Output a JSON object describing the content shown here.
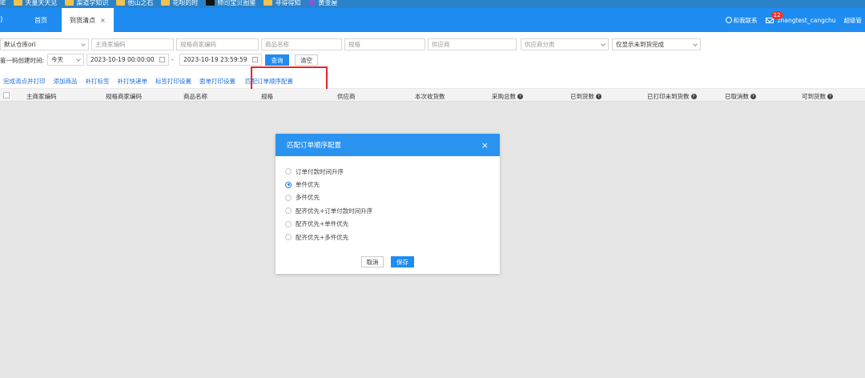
{
  "bookmarks": {
    "items": [
      {
        "label": "IE"
      },
      {
        "label": "天量天天见"
      },
      {
        "label": "渠道学知识"
      },
      {
        "label": "他山之石"
      },
      {
        "label": "花呗的时"
      },
      {
        "label": "帅司宝贝图鉴"
      },
      {
        "label": "寻得得知"
      },
      {
        "label": "黄金屋"
      }
    ]
  },
  "nav": {
    "left_glyph": ")",
    "tabs": [
      {
        "label": "首页"
      },
      {
        "label": "到货清点",
        "close": "×"
      }
    ],
    "support_label": "和我联系",
    "mail_badge": "12",
    "username": "zhangtest_cangchu",
    "admin_label": "超级管"
  },
  "filters": {
    "warehouse": "默认仓库ori",
    "main_code_placeholder": "主商家编码",
    "spec_code_placeholder": "规格商家编码",
    "product_name_placeholder": "商品名称",
    "spec_placeholder": "规格",
    "supplier_placeholder": "供应商",
    "supplier_category_placeholder": "供应商分类",
    "show_incomplete": "仅显示未到货完成",
    "time_label": "鉴一码创建时间:",
    "range": "今天",
    "start_time": "2023-10-19 00:00:00",
    "dash": "-",
    "end_time": "2023-10-19 23:59:59",
    "search_btn": "查询",
    "clear_btn": "清空"
  },
  "actions": {
    "items": [
      {
        "label": "完成清点并打印"
      },
      {
        "label": "添加商品"
      },
      {
        "label": "补打标签"
      },
      {
        "label": "补打快递单"
      },
      {
        "label": "标签打印设置"
      },
      {
        "label": "面单打印设置"
      },
      {
        "label": "匹配订单顺序配置"
      }
    ]
  },
  "table": {
    "columns": [
      {
        "label": "主商家编码",
        "help": false
      },
      {
        "label": "规格商家编码",
        "help": false
      },
      {
        "label": "商品名称",
        "help": false
      },
      {
        "label": "规格",
        "help": false
      },
      {
        "label": "供应商",
        "help": false
      },
      {
        "label": "本次收货数",
        "help": false
      },
      {
        "label": "采购总数",
        "help": true
      },
      {
        "label": "已到货数",
        "help": true
      },
      {
        "label": "已打印未到货数",
        "help": true
      },
      {
        "label": "已取消数",
        "help": true
      },
      {
        "label": "可到货数",
        "help": true
      }
    ]
  },
  "modal": {
    "title": "匹配订单顺序配置",
    "close": "×",
    "options": [
      {
        "label": "订单付款时间升序",
        "selected": false
      },
      {
        "label": "单件优先",
        "selected": true
      },
      {
        "label": "多件优先",
        "selected": false
      },
      {
        "label": "配齐优先+订单付款时间升序",
        "selected": false
      },
      {
        "label": "配齐优先+单件优先",
        "selected": false
      },
      {
        "label": "配齐优先+多件优先",
        "selected": false
      }
    ],
    "cancel": "取消",
    "save": "保存"
  },
  "colors": {
    "primary": "#1e8cf0",
    "highlight": "#e8262a"
  }
}
